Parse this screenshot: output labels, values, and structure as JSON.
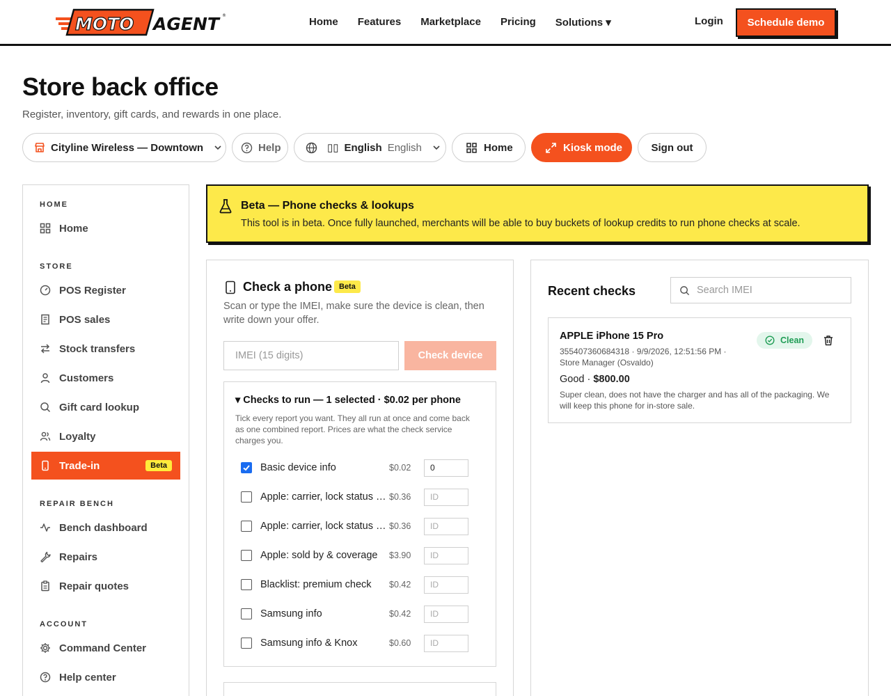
{
  "nav": {
    "brand_moto": "MOTO",
    "brand_agent": "AGENT",
    "links": [
      "Home",
      "Features",
      "Marketplace",
      "Pricing",
      "Solutions ▾"
    ],
    "login": "Login",
    "demo": "Schedule demo"
  },
  "header": {
    "title": "Store back office",
    "subtitle": "Register, inventory, gift cards, and rewards in one place."
  },
  "toolbar": {
    "store": "Cityline Wireless — Downtown",
    "help": "Help",
    "lang_flag": "▯▯",
    "lang_name": "English",
    "lang_native": "English",
    "home": "Home",
    "kiosk": "Kiosk mode",
    "signout": "Sign out"
  },
  "sidebar": {
    "sections": [
      "HOME",
      "STORE",
      "REPAIR BENCH",
      "ACCOUNT"
    ],
    "items": [
      {
        "label": "Home",
        "icon": "grid-icon"
      },
      {
        "label": "POS Register",
        "icon": "register-icon"
      },
      {
        "label": "POS sales",
        "icon": "receipt-icon"
      },
      {
        "label": "Stock transfers",
        "icon": "transfer-icon"
      },
      {
        "label": "Customers",
        "icon": "user-icon"
      },
      {
        "label": "Gift card lookup",
        "icon": "search-icon"
      },
      {
        "label": "Loyalty",
        "icon": "users-icon"
      },
      {
        "label": "Trade-in",
        "icon": "phone-icon",
        "badge": "Beta",
        "active": true
      },
      {
        "label": "Bench dashboard",
        "icon": "activity-icon"
      },
      {
        "label": "Repairs",
        "icon": "wrench-icon"
      },
      {
        "label": "Repair quotes",
        "icon": "clipboard-icon"
      },
      {
        "label": "Command Center",
        "icon": "gear-icon"
      },
      {
        "label": "Help center",
        "icon": "help-icon"
      }
    ]
  },
  "banner": {
    "title": "Beta — Phone checks & lookups",
    "text": "This tool is in beta. Once fully launched, merchants will be able to buy buckets of lookup credits to run phone checks at scale."
  },
  "check_panel": {
    "title": "Check a phone",
    "beta": "Beta",
    "description": "Scan or type the IMEI, make sure the device is clean, then write down your offer.",
    "imei_placeholder": "IMEI (15 digits)",
    "button": "Check device",
    "checks_title": "▾ Checks to run — 1 selected · $0.02 per phone",
    "checks_desc": "Tick every report you want. They all run at once and come back as one combined report. Prices are what the check service charges you.",
    "checks": [
      {
        "name": "Basic device info",
        "price": "$0.02",
        "id": "0",
        "checked": true
      },
      {
        "name": "Apple: carrier, lock status & more",
        "price": "$0.36",
        "id": "ID",
        "checked": false
      },
      {
        "name": "Apple: carrier, lock status & more",
        "price": "$0.36",
        "id": "ID",
        "checked": false
      },
      {
        "name": "Apple: sold by & coverage",
        "price": "$3.90",
        "id": "ID",
        "checked": false
      },
      {
        "name": "Blacklist: premium check",
        "price": "$0.42",
        "id": "ID",
        "checked": false
      },
      {
        "name": "Samsung info",
        "price": "$0.42",
        "id": "ID",
        "checked": false
      },
      {
        "name": "Samsung info & Knox",
        "price": "$0.60",
        "id": "ID",
        "checked": false
      }
    ]
  },
  "recent": {
    "title": "Recent checks",
    "search_placeholder": "Search IMEI",
    "items": [
      {
        "model": "APPLE iPhone 15 Pro",
        "meta": "355407360684318 · 9/9/2026, 12:51:56 PM · Store Manager (Osvaldo)",
        "grade": "Good · ",
        "offer": "$800.00",
        "status": "Clean",
        "note": "Super clean, does not have the charger and has all of the packaging. We will keep this phone for in-store sale."
      }
    ]
  },
  "colors": {
    "accent": "#f4511e",
    "beta": "#fde94a",
    "clean": "#1f9d55",
    "checkbox": "#1a6cf0"
  }
}
